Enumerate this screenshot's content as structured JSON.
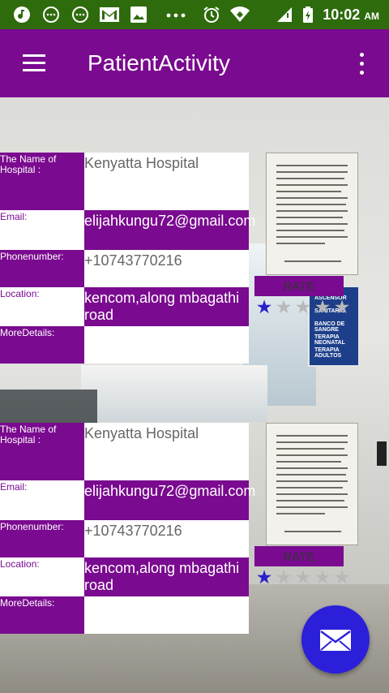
{
  "status_bar": {
    "time": "10:02",
    "ampm": "AM",
    "icons": [
      "music-icon",
      "chat-icon",
      "chat-icon",
      "gmail-icon",
      "image-icon",
      "more-dots-icon",
      "alarm-icon",
      "wifi-icon",
      "signal-icon",
      "battery-charging-icon"
    ]
  },
  "app_bar": {
    "title": "PatientActivity",
    "menu_icon": "hamburger-menu-icon",
    "overflow_icon": "more-vert-icon"
  },
  "cards": [
    {
      "hospital_label": "The Name of Hospital :",
      "hospital_name": "Kenyatta Hospital",
      "email_label": "Email:",
      "email": "elijahkungu72@gmail.com",
      "phone_label": "Phonenumber:",
      "phone": "+10743770216",
      "location_label": "Location:",
      "location": "kencom,along mbagathi road",
      "details_label": "MoreDetails:",
      "details": "",
      "rate_label": "RATE",
      "rating": 1,
      "max_rating": 5
    },
    {
      "hospital_label": "The Name of Hospital :",
      "hospital_name": "Kenyatta Hospital",
      "email_label": "Email:",
      "email": "elijahkungu72@gmail.com",
      "phone_label": "Phonenumber:",
      "phone": "+10743770216",
      "location_label": "Location:",
      "location": "kencom,along mbagathi road",
      "details_label": "MoreDetails:",
      "details": "",
      "rate_label": "RATE",
      "rating": 1,
      "max_rating": 5
    }
  ],
  "background_sign": [
    "ASCENSOR",
    "SANITARIO",
    "BANCO DE SANGRE",
    "TERAPIA NEONATAL",
    "TERAPIA ADULTOS"
  ],
  "fab": {
    "icon": "mail-icon"
  },
  "colors": {
    "primary": "#7a0a8f",
    "status_bar": "#2e6b0c",
    "accent": "#2b1fd9",
    "star_on": "#2a22c9"
  }
}
